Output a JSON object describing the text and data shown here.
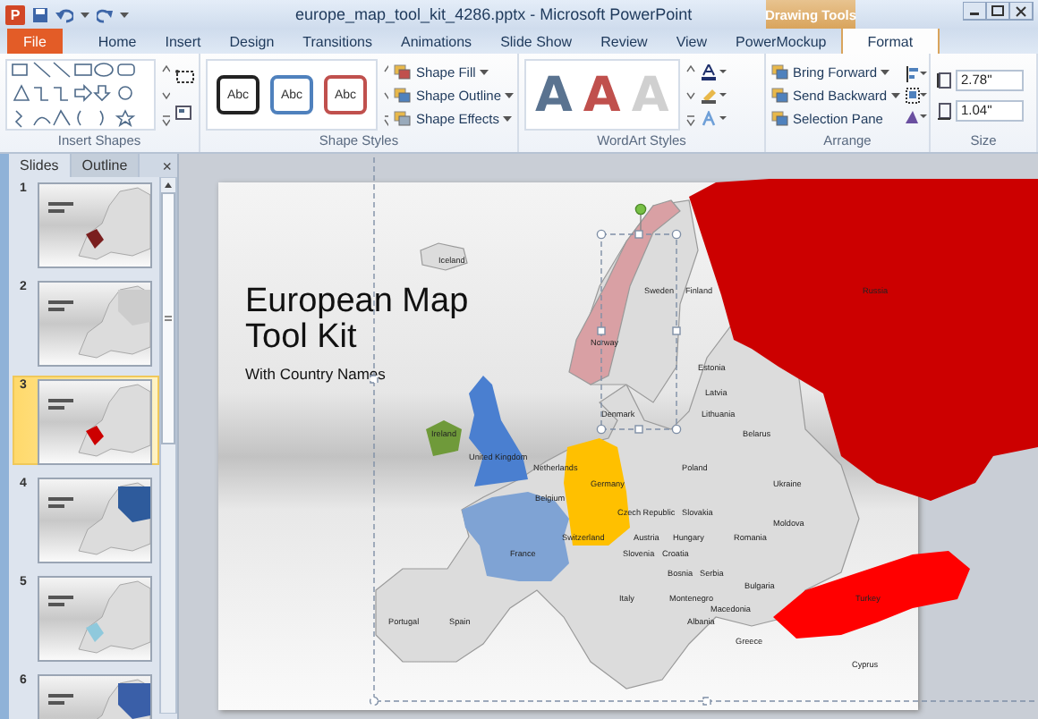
{
  "window": {
    "app_badge": "P",
    "title": "europe_map_tool_kit_4286.pptx - Microsoft PowerPoint",
    "context_tab": "Drawing Tools"
  },
  "tabs": [
    {
      "label": "File",
      "kind": "file",
      "selected": false
    },
    {
      "label": "Home",
      "kind": "tab",
      "selected": false
    },
    {
      "label": "Insert",
      "kind": "tab",
      "selected": false
    },
    {
      "label": "Design",
      "kind": "tab",
      "selected": false
    },
    {
      "label": "Transitions",
      "kind": "tab",
      "selected": false
    },
    {
      "label": "Animations",
      "kind": "tab",
      "selected": false
    },
    {
      "label": "Slide Show",
      "kind": "tab",
      "selected": false
    },
    {
      "label": "Review",
      "kind": "tab",
      "selected": false
    },
    {
      "label": "View",
      "kind": "tab",
      "selected": false
    },
    {
      "label": "PowerMockup",
      "kind": "tab",
      "selected": false
    },
    {
      "label": "Format",
      "kind": "tab",
      "selected": true
    }
  ],
  "insert_shapes": {
    "label": "Insert Shapes"
  },
  "shape_styles": {
    "label": "Shape Styles",
    "presets": [
      {
        "text": "Abc",
        "color": "#222222"
      },
      {
        "text": "Abc",
        "color": "#4f81bd"
      },
      {
        "text": "Abc",
        "color": "#c0504d"
      }
    ],
    "commands": [
      "Shape Fill",
      "Shape Outline",
      "Shape Effects"
    ]
  },
  "wordart_styles": {
    "label": "WordArt Styles",
    "presets": [
      {
        "text": "A",
        "color": "#5a7390"
      },
      {
        "text": "A",
        "color": "#c0504d"
      },
      {
        "text": "A",
        "color": "#d0d0d0"
      }
    ]
  },
  "arrange": {
    "label": "Arrange",
    "commands": [
      "Bring Forward",
      "Send Backward",
      "Selection Pane"
    ]
  },
  "size": {
    "label": "Size",
    "fields": [
      "2.78\"",
      "1.04\""
    ]
  },
  "panel": {
    "tabs": [
      {
        "label": "Slides",
        "selected": true
      },
      {
        "label": "Outline",
        "selected": false
      }
    ],
    "close": "×"
  },
  "slides": [
    {
      "number": "1",
      "selected": false
    },
    {
      "number": "2",
      "selected": false
    },
    {
      "number": "3",
      "selected": true
    },
    {
      "number": "4",
      "selected": false
    },
    {
      "number": "5",
      "selected": false
    },
    {
      "number": "6",
      "selected": false
    }
  ],
  "slide": {
    "title": "European Map Tool Kit",
    "subtitle": "With Country Names"
  },
  "map": {
    "labels": [
      "Iceland",
      "Sweden",
      "Finland",
      "Russia",
      "Norway",
      "Estonia",
      "Latvia",
      "Denmark",
      "Lithuania",
      "Ireland",
      "Belarus",
      "United Kingdom",
      "Netherlands",
      "Poland",
      "Germany",
      "Ukraine",
      "Belgium",
      "Czech Republic",
      "Slovakia",
      "Moldova",
      "Switzerland",
      "Austria",
      "Hungary",
      "Romania",
      "France",
      "Slovenia",
      "Croatia",
      "Bosnia",
      "Serbia",
      "Bulgaria",
      "Italy",
      "Montenegro",
      "Turkey",
      "Macedonia",
      "Portugal",
      "Spain",
      "Albania",
      "Greece",
      "Cyprus"
    ]
  }
}
